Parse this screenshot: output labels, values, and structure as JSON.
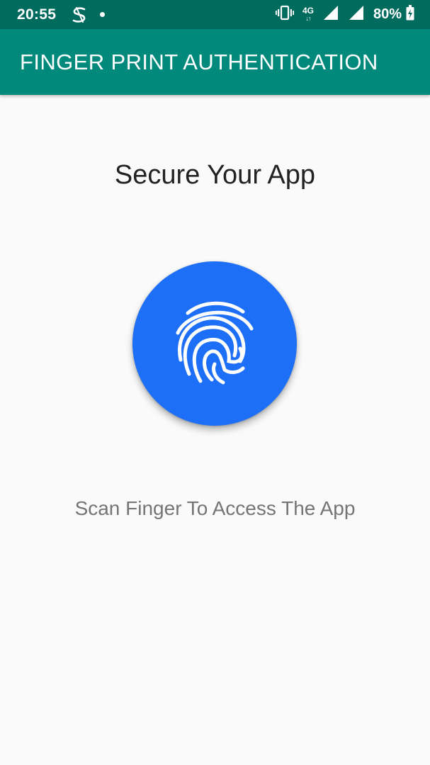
{
  "status_bar": {
    "time": "20:55",
    "app_icon": "s-curve-app-icon",
    "network_type": "4G",
    "battery": "80%",
    "icons": [
      "vibrate-icon",
      "network-4g-icon",
      "signal-icon",
      "signal-icon",
      "battery-charging-icon"
    ]
  },
  "app_bar": {
    "title": "FINGER PRINT AUTHENTICATION",
    "color": "#01897b",
    "status_color": "#016b5e"
  },
  "main": {
    "headline": "Secure Your App",
    "fingerprint_icon": "fingerprint-icon",
    "button_color": "#1d6ff8",
    "caption": "Scan Finger To Access The App"
  }
}
